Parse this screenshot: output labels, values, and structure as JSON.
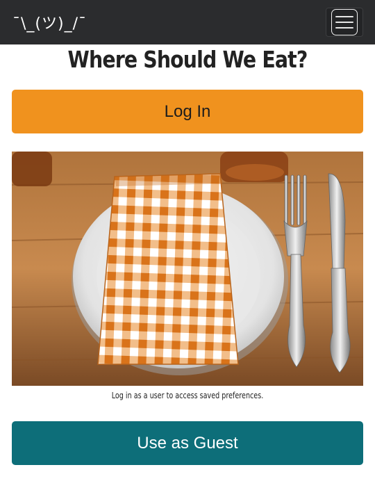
{
  "navbar": {
    "brand": "¯\\_(ツ)_/¯",
    "toggler_icon": "hamburger-menu-icon"
  },
  "page": {
    "title": "Where Should We Eat?",
    "login_label": "Log In",
    "image_subject": "plate with checkered napkin, fork and knife",
    "caption": "Log in as a user to access saved preferences.",
    "guest_label": "Use as Guest"
  },
  "colors": {
    "navbar_bg": "#2b2c2e",
    "login_button": "#f0921e",
    "guest_button": "#0d6e79"
  }
}
